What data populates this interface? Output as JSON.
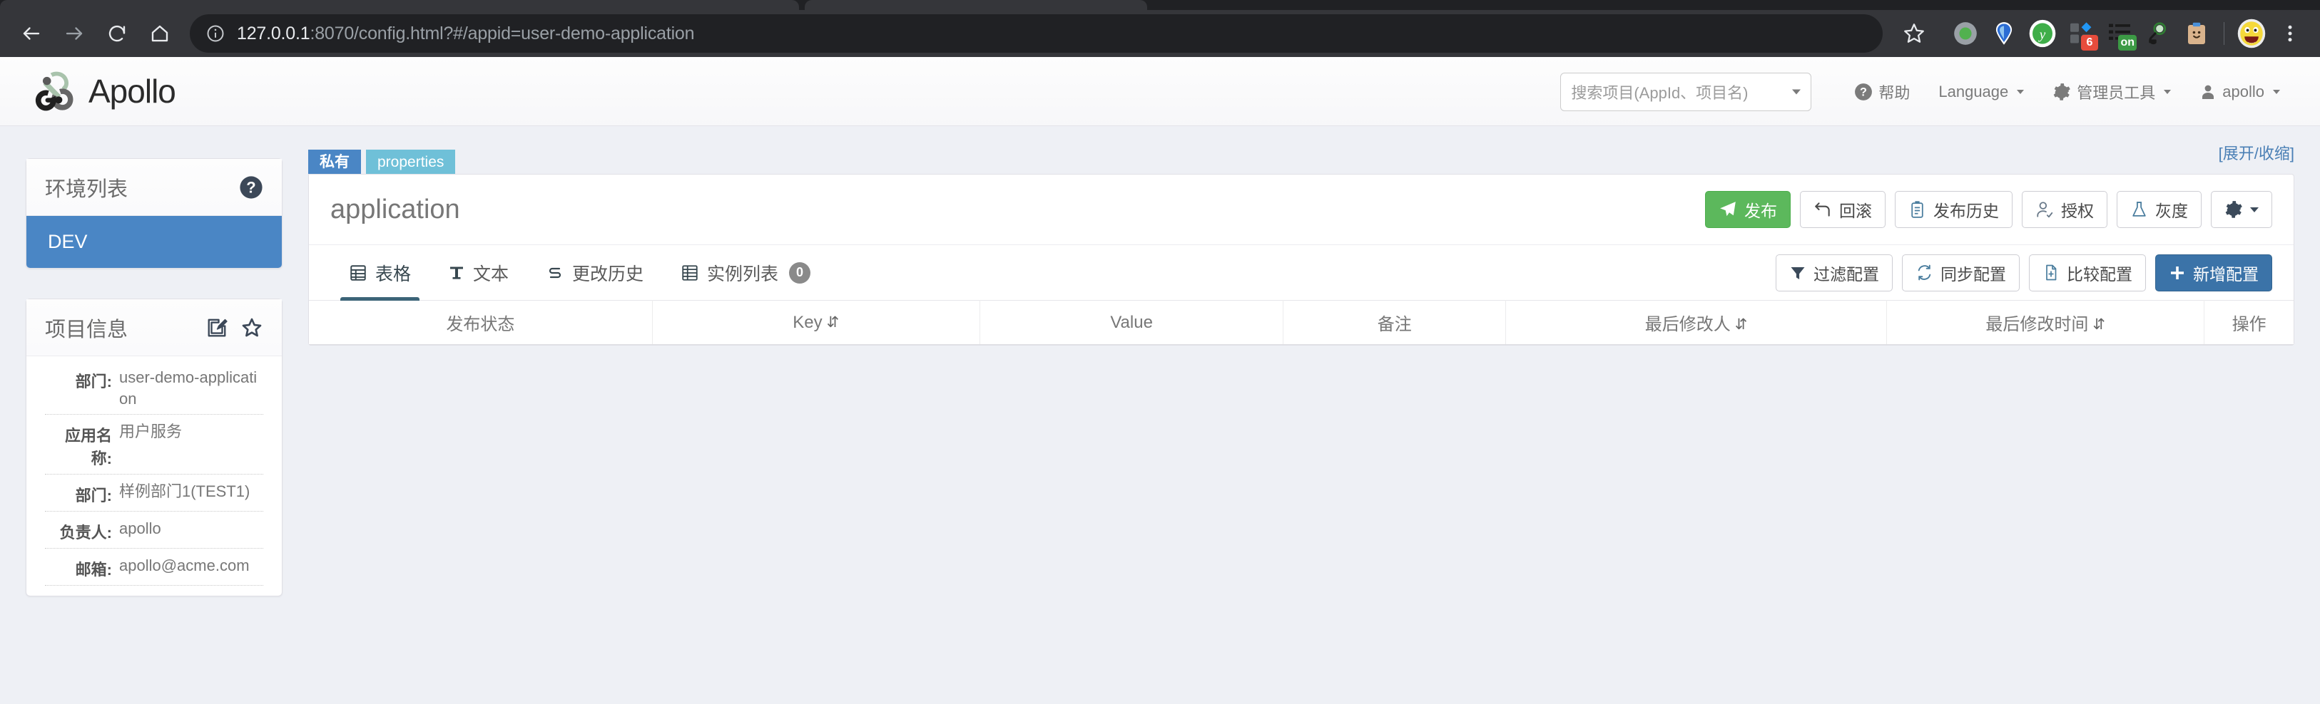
{
  "browser": {
    "url_host": "127.0.0.1",
    "url_rest": ":8070/config.html?#/appid=user-demo-application",
    "back_icon": "back-arrow-icon",
    "forward_icon": "forward-arrow-icon",
    "reload_icon": "reload-icon",
    "home_icon": "home-icon",
    "info_icon": "site-info-icon",
    "bookmark_icon": "star-icon",
    "menu_icon": "chrome-menu-icon",
    "extensions": [
      {
        "name": "green-dot-extension",
        "badge": "",
        "badge_color": ""
      },
      {
        "name": "blue-pin-extension",
        "badge": "",
        "badge_color": ""
      },
      {
        "name": "yandex-extension",
        "badge": "",
        "badge_color": ""
      },
      {
        "name": "blocks-extension",
        "badge": "6",
        "badge_color": "#e74c3c"
      },
      {
        "name": "list-extension",
        "badge": "on",
        "badge_color": "#3c9a45"
      },
      {
        "name": "magnifier-extension",
        "badge": "",
        "badge_color": ""
      },
      {
        "name": "clipboard-extension",
        "badge": "",
        "badge_color": ""
      }
    ],
    "profile_avatar": "emoji-avatar"
  },
  "app_header": {
    "logo_text": "Apollo",
    "search_placeholder": "搜索项目(AppId、项目名)",
    "nav": [
      {
        "label": "帮助",
        "icon": "help-circle-icon",
        "caret": false
      },
      {
        "label": "Language",
        "icon": "",
        "caret": true
      },
      {
        "label": "管理员工具",
        "icon": "gear-icon",
        "caret": true
      },
      {
        "label": "apollo",
        "icon": "user-icon",
        "caret": true
      }
    ]
  },
  "sidebar": {
    "env_card": {
      "title": "环境列表",
      "help_icon": "question-mark-icon",
      "items": [
        {
          "label": "DEV",
          "active": true
        }
      ]
    },
    "project_card": {
      "title": "项目信息",
      "edit_icon": "edit-pencil-icon",
      "favorite_icon": "star-outline-icon",
      "rows": [
        {
          "label": "部门:",
          "value": "user-demo-application"
        },
        {
          "label": "应用名称:",
          "value": "用户服务"
        },
        {
          "label": "部门:",
          "value": "样例部门1(TEST1)"
        },
        {
          "label": "负责人:",
          "value": "apollo"
        },
        {
          "label": "邮箱:",
          "value": "apollo@acme.com"
        }
      ]
    }
  },
  "main": {
    "tags": [
      {
        "label": "私有",
        "kind": "private"
      },
      {
        "label": "properties",
        "kind": "format"
      }
    ],
    "expand_link": "[展开/收缩]",
    "namespace_title": "application",
    "title_buttons": [
      {
        "label": "发布",
        "icon": "paper-plane-icon",
        "style": "green"
      },
      {
        "label": "回滚",
        "icon": "rollback-arrow-icon",
        "style": "default"
      },
      {
        "label": "发布历史",
        "icon": "clipboard-list-icon",
        "style": "default"
      },
      {
        "label": "授权",
        "icon": "user-check-icon",
        "style": "default"
      },
      {
        "label": "灰度",
        "icon": "flask-icon",
        "style": "default"
      },
      {
        "label": "",
        "icon": "gear-icon",
        "style": "default",
        "caret": true
      }
    ],
    "tabs": [
      {
        "label": "表格",
        "icon": "table-icon",
        "active": true,
        "badge": ""
      },
      {
        "label": "文本",
        "icon": "text-T-icon",
        "active": false,
        "badge": ""
      },
      {
        "label": "更改历史",
        "icon": "history-icon",
        "active": false,
        "badge": ""
      },
      {
        "label": "实例列表",
        "icon": "instances-icon",
        "active": false,
        "badge": "0"
      }
    ],
    "tab_buttons": [
      {
        "label": "过滤配置",
        "icon": "filter-icon",
        "style": "default"
      },
      {
        "label": "同步配置",
        "icon": "sync-icon",
        "style": "default"
      },
      {
        "label": "比较配置",
        "icon": "compare-icon",
        "style": "default"
      },
      {
        "label": "新增配置",
        "icon": "plus-icon",
        "style": "blue"
      }
    ],
    "table": {
      "columns": [
        {
          "label": "发布状态",
          "sortable": false
        },
        {
          "label": "Key",
          "sortable": true
        },
        {
          "label": "Value",
          "sortable": false
        },
        {
          "label": "备注",
          "sortable": false
        },
        {
          "label": "最后修改人",
          "sortable": true
        },
        {
          "label": "最后修改时间",
          "sortable": true
        },
        {
          "label": "操作",
          "sortable": false
        }
      ],
      "rows": []
    }
  },
  "colors": {
    "accent_blue": "#4a86c5",
    "tag_format": "#6fc0d8",
    "publish_green": "#5cb85c",
    "add_blue": "#3b73a8",
    "page_bg": "#eef0f5",
    "dark_navy": "#3c4858"
  }
}
